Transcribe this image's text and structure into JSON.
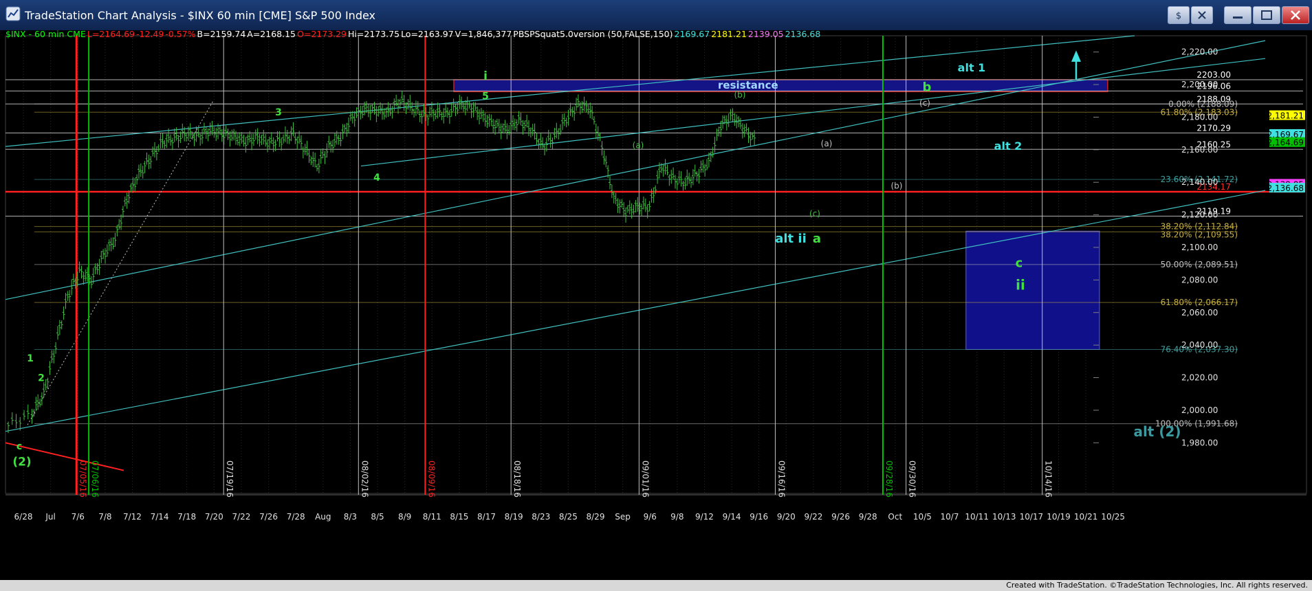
{
  "window": {
    "title": "TradeStation Chart Analysis - $INX 60 min [CME] S&P 500 Index",
    "buttons": [
      "minimize-button",
      "restore-button",
      "close-button"
    ]
  },
  "info_line": [
    {
      "text": "$INX - 60 min  CME",
      "color": "#00ff00"
    },
    {
      "text": "L=2164.69",
      "color": "#ff2020"
    },
    {
      "text": "-12.49",
      "color": "#ff2020"
    },
    {
      "text": "-0.57%",
      "color": "#ff2020"
    },
    {
      "text": "B=2159.74",
      "color": "#ffffff"
    },
    {
      "text": "A=2168.15",
      "color": "#ffffff"
    },
    {
      "text": "O=2173.29",
      "color": "#ff2020"
    },
    {
      "text": "Hi=2173.75",
      "color": "#ffffff"
    },
    {
      "text": "Lo=2163.97",
      "color": "#ffffff"
    },
    {
      "text": "V=1,846,377",
      "color": "#ffffff"
    },
    {
      "text": "PBSPSquat5.0version (50,FALSE,150)",
      "color": "#ffffff"
    },
    {
      "text": "2169.67",
      "color": "#40e0e0"
    },
    {
      "text": "2181.21",
      "color": "#ffff00"
    },
    {
      "text": "2139.05",
      "color": "#ff70ff"
    },
    {
      "text": "2136.68",
      "color": "#40e0e0"
    }
  ],
  "status_bar": "Created with TradeStation. ©TradeStation Technologies, Inc. All rights reserved.",
  "chart_data": {
    "type": "candlestick",
    "title": "$INX 60 min [CME] S&P 500 Index",
    "ylim": [
      1970,
      2230
    ],
    "y_ticks": [
      1980,
      2000,
      2020,
      2040,
      2060,
      2080,
      2100,
      2120,
      2140,
      2160,
      2180,
      2200,
      2220
    ],
    "y_tick_labels": [
      "1,980.00",
      "2,000.00",
      "2,020.00",
      "2,040.00",
      "2,060.00",
      "2,080.00",
      "2,100.00",
      "2,120.00",
      "2,140.00",
      "2,160.00",
      "2,180.00",
      "2,200.00",
      "2,220.00"
    ],
    "x_labels": [
      "6/28",
      "Jul",
      "7/6",
      "7/8",
      "7/12",
      "7/14",
      "7/18",
      "7/20",
      "7/22",
      "7/26",
      "7/28",
      "Aug",
      "8/3",
      "8/5",
      "8/9",
      "8/11",
      "8/15",
      "8/17",
      "8/19",
      "8/23",
      "8/25",
      "8/29",
      "Sep",
      "9/6",
      "9/8",
      "9/12",
      "9/14",
      "9/16",
      "9/20",
      "9/22",
      "9/26",
      "9/28",
      "Oct",
      "10/5",
      "10/7",
      "10/11",
      "10/13",
      "10/17",
      "10/19",
      "10/21",
      "10/25"
    ],
    "price_path": [
      [
        0,
        1991
      ],
      [
        2,
        1998
      ],
      [
        3,
        2010
      ],
      [
        4,
        2040
      ],
      [
        5,
        2070
      ],
      [
        6,
        2085
      ],
      [
        7,
        2080
      ],
      [
        8,
        2095
      ],
      [
        9,
        2105
      ],
      [
        10,
        2130
      ],
      [
        11,
        2145
      ],
      [
        12,
        2155
      ],
      [
        13,
        2165
      ],
      [
        14,
        2167
      ],
      [
        15,
        2170
      ],
      [
        16,
        2168
      ],
      [
        17,
        2172
      ],
      [
        18,
        2170
      ],
      [
        19,
        2168
      ],
      [
        20,
        2165
      ],
      [
        21,
        2168
      ],
      [
        22,
        2164
      ],
      [
        23,
        2166
      ],
      [
        24,
        2170
      ],
      [
        25,
        2160
      ],
      [
        26,
        2150
      ],
      [
        27,
        2162
      ],
      [
        28,
        2168
      ],
      [
        29,
        2180
      ],
      [
        30,
        2185
      ],
      [
        31,
        2184
      ],
      [
        32,
        2183
      ],
      [
        33,
        2190
      ],
      [
        34,
        2186
      ],
      [
        35,
        2181
      ],
      [
        36,
        2183
      ],
      [
        37,
        2182
      ],
      [
        38,
        2188
      ],
      [
        39,
        2186
      ],
      [
        40,
        2180
      ],
      [
        41,
        2175
      ],
      [
        42,
        2172
      ],
      [
        43,
        2178
      ],
      [
        44,
        2173
      ],
      [
        45,
        2162
      ],
      [
        46,
        2168
      ],
      [
        47,
        2179
      ],
      [
        48,
        2188
      ],
      [
        49,
        2185
      ],
      [
        50,
        2162
      ],
      [
        51,
        2130
      ],
      [
        52,
        2122
      ],
      [
        53,
        2125
      ],
      [
        54,
        2125
      ],
      [
        55,
        2150
      ],
      [
        56,
        2142
      ],
      [
        57,
        2140
      ],
      [
        58,
        2145
      ],
      [
        59,
        2152
      ],
      [
        60,
        2175
      ],
      [
        61,
        2181
      ],
      [
        62,
        2172
      ],
      [
        63,
        2165
      ]
    ],
    "horizontal_levels": [
      {
        "value": 2203.0,
        "label": "2203.00",
        "color": "#ffffff"
      },
      {
        "value": 2196.06,
        "label": "2196.06",
        "color": "#ffffff"
      },
      {
        "value": 2188.09,
        "label": "2188.09",
        "color": "#ffffff"
      },
      {
        "value": 2170.29,
        "label": "2170.29",
        "color": "#ffffff"
      },
      {
        "value": 2160.25,
        "label": "2160.25",
        "color": "#ffffff"
      },
      {
        "value": 2134.17,
        "label": "2134.17",
        "color": "#ff3030"
      },
      {
        "value": 2119.19,
        "label": "2119.19",
        "color": "#ffffff"
      }
    ],
    "fib_levels": [
      {
        "value": 2188.09,
        "label": "0.00% (2188.09)",
        "color": "#c0c0c0"
      },
      {
        "value": 2183.03,
        "label": "61.80% (2,183.03)",
        "color": "#c8b040"
      },
      {
        "value": 2141.72,
        "label": "23.60% (2,141.72)",
        "color": "#40a0a0"
      },
      {
        "value": 2112.84,
        "label": "38.20% (2,112.84)",
        "color": "#c8b040"
      },
      {
        "value": 2109.55,
        "label": "38.20% (2,109.55)",
        "color": "#c8b040"
      },
      {
        "value": 2089.51,
        "label": "50.00% (2,089.51)",
        "color": "#c0c0c0"
      },
      {
        "value": 2066.17,
        "label": "61.80% (2,066.17)",
        "color": "#c8b040"
      },
      {
        "value": 2037.3,
        "label": "76.40% (2,037.30)",
        "color": "#40a0a0"
      },
      {
        "value": 1991.68,
        "label": "100.00% (1,991.68)",
        "color": "#c0c0c0"
      }
    ],
    "price_tags": [
      {
        "value": 2181.21,
        "label": "2,181.21",
        "bg": "#ffff00",
        "fg": "#000"
      },
      {
        "value": 2169.67,
        "label": "2,169.67",
        "bg": "#40e0e0",
        "fg": "#000"
      },
      {
        "value": 2164.69,
        "label": "2,164.69",
        "bg": "#00c000",
        "fg": "#000"
      },
      {
        "value": 2139.05,
        "label": "2,139.05",
        "bg": "#ff40ff",
        "fg": "#000"
      },
      {
        "value": 2136.68,
        "label": "2,136.68",
        "bg": "#40e0e0",
        "fg": "#000"
      }
    ],
    "vertical_dates": [
      "07/05/16",
      "07/06/16",
      "07/19/16",
      "08/02/16",
      "08/09/16",
      "08/18/16",
      "09/01/16",
      "09/16/16",
      "09/28/16",
      "09/30/16",
      "10/14/16"
    ],
    "resistance_label": "resistance",
    "wave_labels": [
      "c",
      "(2)",
      "1",
      "2",
      "3",
      "4",
      "i",
      "5",
      "(a)",
      "(b)",
      "(c)",
      "(a)",
      "(b)",
      "(c)",
      "alt ii",
      "a",
      "b",
      "alt 1",
      "alt 2",
      "c",
      "ii",
      "alt (2)"
    ]
  }
}
